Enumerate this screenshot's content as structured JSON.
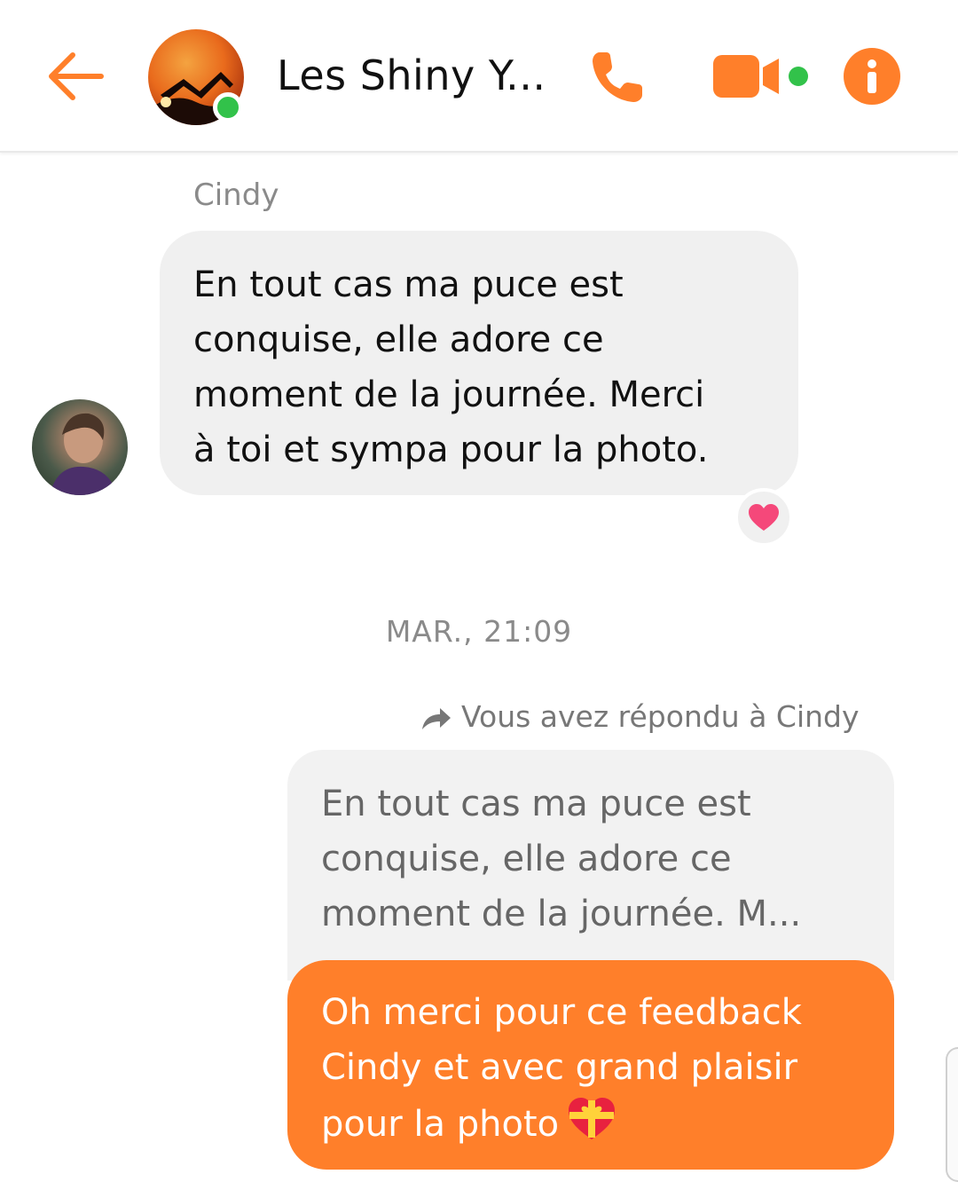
{
  "header": {
    "title": "Les Shiny Y...",
    "online": true,
    "icons": {
      "back": "back-arrow-icon",
      "call": "phone-icon",
      "video": "video-camera-icon",
      "info": "info-icon"
    },
    "accent_color": "#ff7f2a"
  },
  "conversation": {
    "incoming": {
      "sender": "Cindy",
      "text": "En tout cas ma puce est\nconquise,  elle adore ce\nmoment de la journée.  Merci\nà  toi et sympa pour la photo.",
      "reaction": "heart"
    },
    "timestamp": "MAR., 21:09",
    "reply": {
      "note": "Vous avez répondu à Cindy",
      "quoted_text": "En tout cas ma puce est\nconquise,  elle adore ce\nmoment de la journée.  M...",
      "text": "Oh merci pour ce feedback\nCindy et avec grand plaisir\npour la photo",
      "emoji": "gift-heart"
    }
  }
}
